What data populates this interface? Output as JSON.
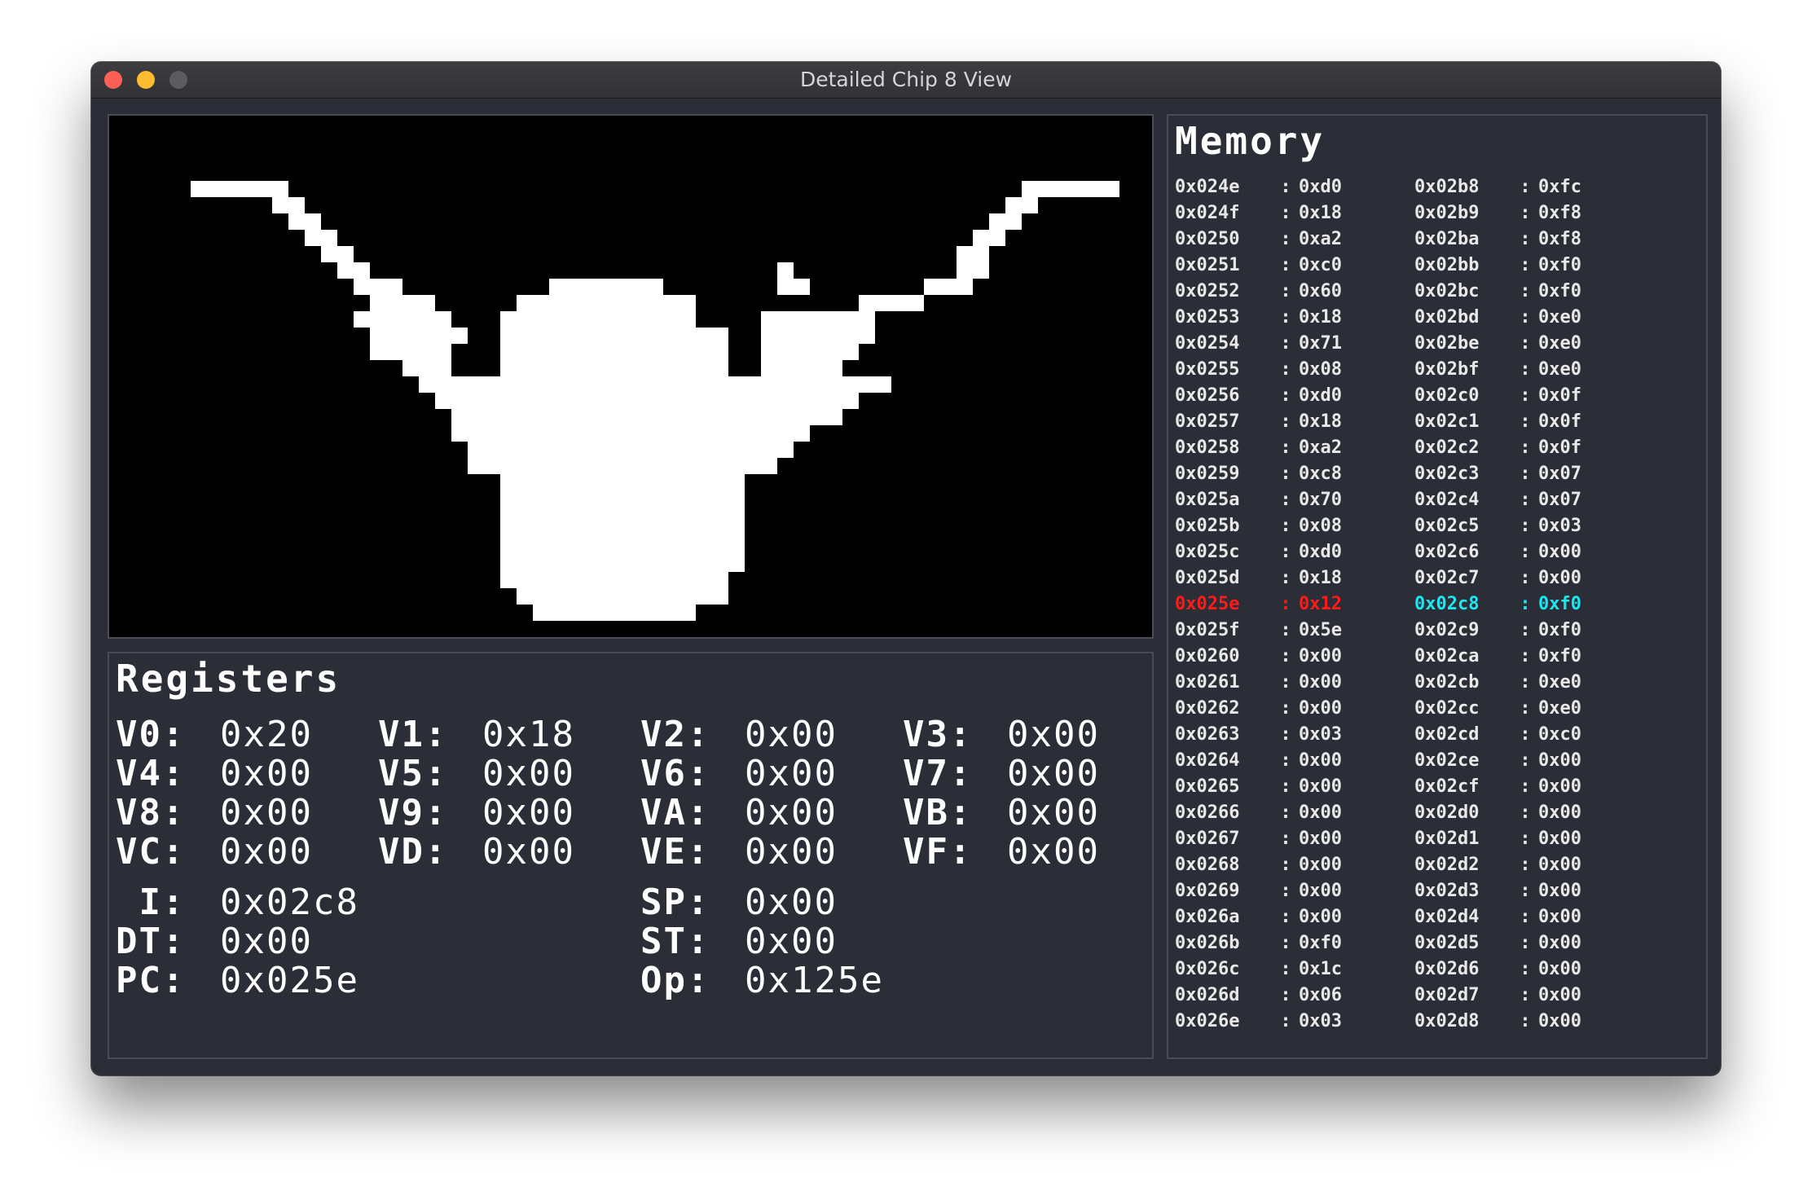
{
  "window": {
    "title": "Detailed Chip 8 View"
  },
  "display": {
    "description_icon": "longhorn-sprite",
    "pixels": [
      "................................................................",
      "................................................................",
      "................................................................",
      "................................................................",
      ".....######.............................................######..",
      "..........##...........................................##.......",
      "...........##.........................................##........",
      "............##.......................................##.........",
      ".............##.....................................##..........",
      "..............##.........................#..........##..........",
      "...............###.........#######.......##.......###...........",
      "................####.....###########..........####.............",
      "...............######...############....#######................",
      "................######..##############..#######................",
      "................#####...##############..######.................",
      "..................###...##############..#####..................",
      "...................#############################...............",
      "....................##########################.................",
      ".....................########################..................",
      ".....................######################....................",
      "......................####################.....................",
      "......................###################......................",
      "........................###############........................",
      "........................###############........................",
      "........................###############........................",
      "........................###############........................",
      "........................###############........................",
      "........................###############........................",
      "........................##############.........................",
      ".........................#############.........................",
      "..........................##########...........................",
      "................................................................"
    ]
  },
  "registers": {
    "title": "Registers",
    "general": [
      {
        "label": "V0:",
        "value": "0x20"
      },
      {
        "label": "V1:",
        "value": "0x18"
      },
      {
        "label": "V2:",
        "value": "0x00"
      },
      {
        "label": "V3:",
        "value": "0x00"
      },
      {
        "label": "V4:",
        "value": "0x00"
      },
      {
        "label": "V5:",
        "value": "0x00"
      },
      {
        "label": "V6:",
        "value": "0x00"
      },
      {
        "label": "V7:",
        "value": "0x00"
      },
      {
        "label": "V8:",
        "value": "0x00"
      },
      {
        "label": "V9:",
        "value": "0x00"
      },
      {
        "label": "VA:",
        "value": "0x00"
      },
      {
        "label": "VB:",
        "value": "0x00"
      },
      {
        "label": "VC:",
        "value": "0x00"
      },
      {
        "label": "VD:",
        "value": "0x00"
      },
      {
        "label": "VE:",
        "value": "0x00"
      },
      {
        "label": "VF:",
        "value": "0x00"
      }
    ],
    "special": [
      {
        "label": " I:",
        "value": "0x02c8"
      },
      {
        "label": "SP:",
        "value": "0x00"
      },
      {
        "label": "DT:",
        "value": "0x00"
      },
      {
        "label": "ST:",
        "value": "0x00"
      },
      {
        "label": "PC:",
        "value": "0x025e"
      },
      {
        "label": "Op:",
        "value": "0x125e"
      }
    ]
  },
  "memory": {
    "title": "Memory",
    "separator": ":",
    "pc_color": "#ff1a1a",
    "i_color": "#1ee6f0",
    "left": [
      {
        "addr": "0x024e",
        "val": "0xd0"
      },
      {
        "addr": "0x024f",
        "val": "0x18"
      },
      {
        "addr": "0x0250",
        "val": "0xa2"
      },
      {
        "addr": "0x0251",
        "val": "0xc0"
      },
      {
        "addr": "0x0252",
        "val": "0x60"
      },
      {
        "addr": "0x0253",
        "val": "0x18"
      },
      {
        "addr": "0x0254",
        "val": "0x71"
      },
      {
        "addr": "0x0255",
        "val": "0x08"
      },
      {
        "addr": "0x0256",
        "val": "0xd0"
      },
      {
        "addr": "0x0257",
        "val": "0x18"
      },
      {
        "addr": "0x0258",
        "val": "0xa2"
      },
      {
        "addr": "0x0259",
        "val": "0xc8"
      },
      {
        "addr": "0x025a",
        "val": "0x70"
      },
      {
        "addr": "0x025b",
        "val": "0x08"
      },
      {
        "addr": "0x025c",
        "val": "0xd0"
      },
      {
        "addr": "0x025d",
        "val": "0x18"
      },
      {
        "addr": "0x025e",
        "val": "0x12",
        "highlight": "pc"
      },
      {
        "addr": "0x025f",
        "val": "0x5e"
      },
      {
        "addr": "0x0260",
        "val": "0x00"
      },
      {
        "addr": "0x0261",
        "val": "0x00"
      },
      {
        "addr": "0x0262",
        "val": "0x00"
      },
      {
        "addr": "0x0263",
        "val": "0x03"
      },
      {
        "addr": "0x0264",
        "val": "0x00"
      },
      {
        "addr": "0x0265",
        "val": "0x00"
      },
      {
        "addr": "0x0266",
        "val": "0x00"
      },
      {
        "addr": "0x0267",
        "val": "0x00"
      },
      {
        "addr": "0x0268",
        "val": "0x00"
      },
      {
        "addr": "0x0269",
        "val": "0x00"
      },
      {
        "addr": "0x026a",
        "val": "0x00"
      },
      {
        "addr": "0x026b",
        "val": "0xf0"
      },
      {
        "addr": "0x026c",
        "val": "0x1c"
      },
      {
        "addr": "0x026d",
        "val": "0x06"
      },
      {
        "addr": "0x026e",
        "val": "0x03"
      }
    ],
    "right": [
      {
        "addr": "0x02b8",
        "val": "0xfc"
      },
      {
        "addr": "0x02b9",
        "val": "0xf8"
      },
      {
        "addr": "0x02ba",
        "val": "0xf8"
      },
      {
        "addr": "0x02bb",
        "val": "0xf0"
      },
      {
        "addr": "0x02bc",
        "val": "0xf0"
      },
      {
        "addr": "0x02bd",
        "val": "0xe0"
      },
      {
        "addr": "0x02be",
        "val": "0xe0"
      },
      {
        "addr": "0x02bf",
        "val": "0xe0"
      },
      {
        "addr": "0x02c0",
        "val": "0x0f"
      },
      {
        "addr": "0x02c1",
        "val": "0x0f"
      },
      {
        "addr": "0x02c2",
        "val": "0x0f"
      },
      {
        "addr": "0x02c3",
        "val": "0x07"
      },
      {
        "addr": "0x02c4",
        "val": "0x07"
      },
      {
        "addr": "0x02c5",
        "val": "0x03"
      },
      {
        "addr": "0x02c6",
        "val": "0x00"
      },
      {
        "addr": "0x02c7",
        "val": "0x00"
      },
      {
        "addr": "0x02c8",
        "val": "0xf0",
        "highlight": "i"
      },
      {
        "addr": "0x02c9",
        "val": "0xf0"
      },
      {
        "addr": "0x02ca",
        "val": "0xf0"
      },
      {
        "addr": "0x02cb",
        "val": "0xe0"
      },
      {
        "addr": "0x02cc",
        "val": "0xe0"
      },
      {
        "addr": "0x02cd",
        "val": "0xc0"
      },
      {
        "addr": "0x02ce",
        "val": "0x00"
      },
      {
        "addr": "0x02cf",
        "val": "0x00"
      },
      {
        "addr": "0x02d0",
        "val": "0x00"
      },
      {
        "addr": "0x02d1",
        "val": "0x00"
      },
      {
        "addr": "0x02d2",
        "val": "0x00"
      },
      {
        "addr": "0x02d3",
        "val": "0x00"
      },
      {
        "addr": "0x02d4",
        "val": "0x00"
      },
      {
        "addr": "0x02d5",
        "val": "0x00"
      },
      {
        "addr": "0x02d6",
        "val": "0x00"
      },
      {
        "addr": "0x02d7",
        "val": "0x00"
      },
      {
        "addr": "0x02d8",
        "val": "0x00"
      }
    ]
  }
}
